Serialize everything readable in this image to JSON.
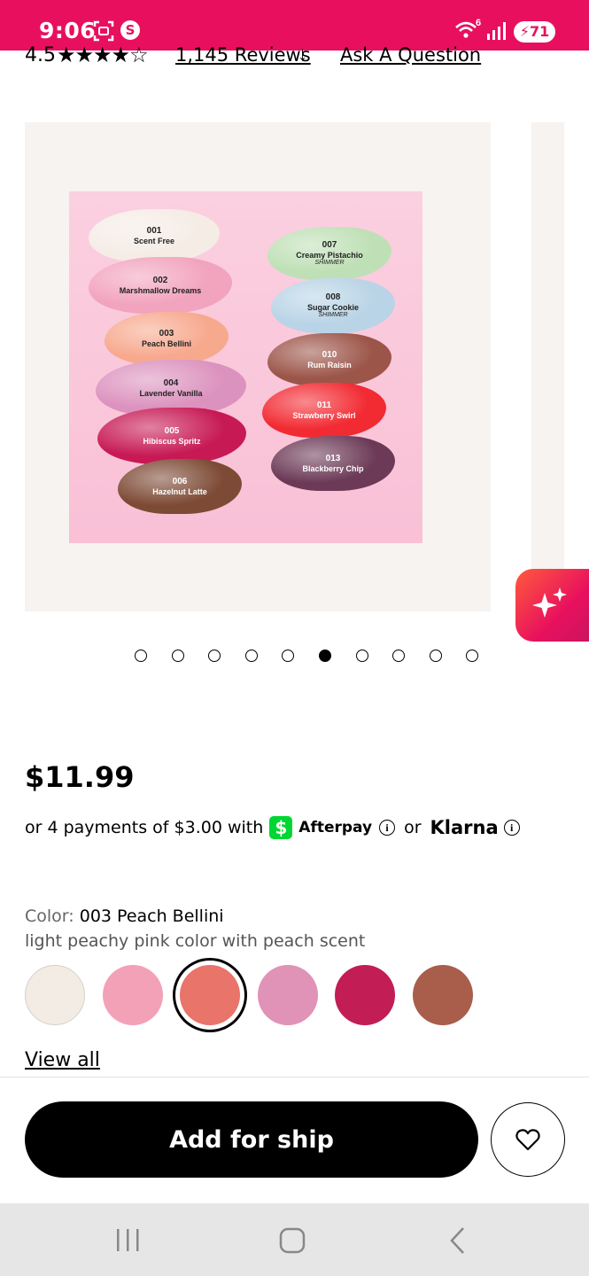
{
  "status_bar": {
    "time": "9:06",
    "signal_badge": "6",
    "battery": "71",
    "background": "#e8105e"
  },
  "rating": {
    "value": "4.5",
    "stars": "★★★★☆",
    "reviews_link": "1,145 Reviews",
    "ask_link": "Ask A Question"
  },
  "gallery": {
    "active_index": 5,
    "total_images": 10,
    "swatches": [
      {
        "code": "001",
        "name": "Scent Free",
        "note": "",
        "color": "#f5ece6"
      },
      {
        "code": "002",
        "name": "Marshmallow Dreams",
        "note": "",
        "color": "#f2a3bd"
      },
      {
        "code": "003",
        "name": "Peach Bellini",
        "note": "",
        "color": "#f7a98e"
      },
      {
        "code": "004",
        "name": "Lavender Vanilla",
        "note": "",
        "color": "#dc92be"
      },
      {
        "code": "005",
        "name": "Hibiscus Spritz",
        "note": "",
        "color": "#c71a55"
      },
      {
        "code": "006",
        "name": "Hazelnut Latte",
        "note": "",
        "color": "#7d4a35"
      },
      {
        "code": "007",
        "name": "Creamy Pistachio",
        "note": "SHIMMER",
        "color": "#bfe0b6"
      },
      {
        "code": "008",
        "name": "Sugar Cookie",
        "note": "SHIMMER",
        "color": "#b9d4e6"
      },
      {
        "code": "010",
        "name": "Rum Raisin",
        "note": "",
        "color": "#9c5549"
      },
      {
        "code": "011",
        "name": "Strawberry Swirl",
        "note": "",
        "color": "#f22a32"
      },
      {
        "code": "013",
        "name": "Blackberry Chip",
        "note": "",
        "color": "#6c3a57"
      }
    ]
  },
  "price": {
    "amount": "$11.99",
    "payments_text": "or 4 payments of $3.00 with",
    "afterpay": "Afterpay",
    "or": "or",
    "klarna": "Klarna"
  },
  "color": {
    "label": "Color:",
    "selected": "003 Peach Bellini",
    "description": "light peachy pink color with peach scent",
    "swatches": [
      "#f3ece4",
      "#f3a1b7",
      "#e8746a",
      "#e192b7",
      "#c21d54",
      "#a85e4b"
    ],
    "selected_index": 2,
    "view_all": "View all"
  },
  "actions": {
    "add_label": "Add for ship"
  }
}
